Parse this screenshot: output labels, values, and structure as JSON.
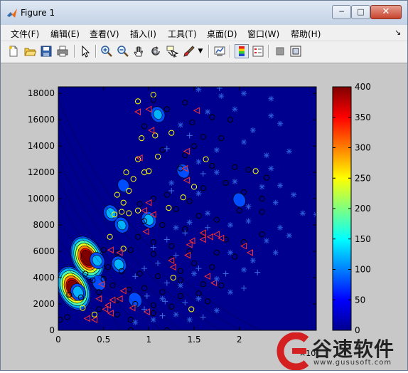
{
  "window": {
    "title": "Figure 1",
    "minimize_glyph": "─",
    "maximize_glyph": "□",
    "close_glyph": "✕"
  },
  "menu": {
    "items": [
      "文件(F)",
      "编辑(E)",
      "查看(V)",
      "插入(I)",
      "工具(T)",
      "桌面(D)",
      "窗口(W)",
      "帮助(H)"
    ],
    "arrow_glyph": "↘"
  },
  "toolbar": {
    "tools": [
      "new-figure-icon",
      "open-file-icon",
      "save-icon",
      "print-icon",
      "edit-plot-arrow-icon",
      "zoom-in-icon",
      "zoom-out-icon",
      "pan-hand-icon",
      "rotate-3d-icon",
      "data-cursor-icon",
      "brush-icon",
      "link-plot-icon",
      "colorbar-icon",
      "legend-icon",
      "hide-plot-tools-icon",
      "show-plot-tools-icon"
    ]
  },
  "chart_data": {
    "type": "heatmap",
    "plot_kind": "filled contour with scatter overlay",
    "title": "",
    "xlabel": "",
    "ylabel": "",
    "x_exponent_label": "×10",
    "xlim": [
      0,
      2.85
    ],
    "ylim": [
      0,
      18500
    ],
    "x_ticks": [
      0,
      0.5,
      1,
      1.5,
      2
    ],
    "x_tick_labels": [
      "0",
      "0.5",
      "1",
      "1.5",
      "2"
    ],
    "y_ticks": [
      0,
      2000,
      4000,
      6000,
      8000,
      10000,
      12000,
      14000,
      16000,
      18000
    ],
    "y_tick_labels": [
      "0",
      "2000",
      "4000",
      "6000",
      "8000",
      "10000",
      "12000",
      "14000",
      "16000",
      "18000"
    ],
    "colorbar": {
      "colormap": "jet",
      "min": 0,
      "max": 400,
      "ticks": [
        0,
        50,
        100,
        150,
        200,
        250,
        300,
        350,
        400
      ],
      "tick_labels": [
        "0",
        "50",
        "100",
        "150",
        "200",
        "250",
        "300",
        "350",
        "400"
      ]
    },
    "hotspots": [
      {
        "x": 0.17,
        "y": 3200,
        "peak": 400
      },
      {
        "x": 0.32,
        "y": 5500,
        "peak": 390
      },
      {
        "x": 0.22,
        "y": 2900,
        "peak": 120
      },
      {
        "x": 0.43,
        "y": 5300,
        "peak": 110
      },
      {
        "x": 0.58,
        "y": 8900,
        "peak": 110
      },
      {
        "x": 1.0,
        "y": 8400,
        "peak": 110
      },
      {
        "x": 0.67,
        "y": 5000,
        "peak": 110
      },
      {
        "x": 1.1,
        "y": 16400,
        "peak": 100
      },
      {
        "x": 0.7,
        "y": 8000,
        "peak": 100
      },
      {
        "x": 0.85,
        "y": 2300,
        "peak": 90
      },
      {
        "x": 0.45,
        "y": 3600,
        "peak": 90
      },
      {
        "x": 1.38,
        "y": 12100,
        "peak": 80
      },
      {
        "x": 2.0,
        "y": 9900,
        "peak": 80
      },
      {
        "x": 0.72,
        "y": 11000,
        "peak": 70
      }
    ],
    "series": [
      {
        "marker": "circle-yellow",
        "color": "#ffff00",
        "points": [
          [
            0.88,
            17400
          ],
          [
            1.05,
            17900
          ],
          [
            0.92,
            14600
          ],
          [
            1.07,
            14800
          ],
          [
            1.25,
            15000
          ],
          [
            0.88,
            13000
          ],
          [
            0.95,
            12000
          ],
          [
            1.0,
            12100
          ],
          [
            0.75,
            12000
          ],
          [
            0.83,
            11500
          ],
          [
            0.65,
            10300
          ],
          [
            0.78,
            10600
          ],
          [
            0.72,
            9700
          ],
          [
            0.62,
            8800
          ],
          [
            0.7,
            9000
          ],
          [
            0.78,
            8900
          ],
          [
            0.88,
            9100
          ],
          [
            1.22,
            9300
          ],
          [
            1.38,
            10100
          ],
          [
            1.5,
            10900
          ],
          [
            1.63,
            13000
          ],
          [
            2.18,
            12100
          ],
          [
            0.57,
            7100
          ],
          [
            0.27,
            1700
          ],
          [
            0.4,
            1200
          ],
          [
            1.27,
            4000
          ],
          [
            1.47,
            1600
          ],
          [
            0.72,
            6200
          ],
          [
            1.1,
            13200
          ]
        ]
      },
      {
        "marker": "circle-black",
        "color": "#000000",
        "points": [
          [
            1.05,
            17500
          ],
          [
            1.4,
            17300
          ],
          [
            1.2,
            16800
          ],
          [
            1.48,
            15800
          ],
          [
            1.7,
            16200
          ],
          [
            1.9,
            16000
          ],
          [
            0.95,
            15500
          ],
          [
            1.6,
            14700
          ],
          [
            1.8,
            14600
          ],
          [
            1.5,
            14000
          ],
          [
            1.15,
            13700
          ],
          [
            1.4,
            13300
          ],
          [
            1.7,
            12500
          ],
          [
            1.95,
            12400
          ],
          [
            2.1,
            12200
          ],
          [
            2.3,
            11600
          ],
          [
            1.85,
            11200
          ],
          [
            1.6,
            10800
          ],
          [
            2.05,
            10500
          ],
          [
            2.25,
            10000
          ],
          [
            1.05,
            10000
          ],
          [
            1.2,
            10300
          ],
          [
            1.45,
            9800
          ],
          [
            1.3,
            9200
          ],
          [
            1.55,
            8700
          ],
          [
            1.75,
            8400
          ],
          [
            2.0,
            9100
          ],
          [
            2.25,
            9000
          ],
          [
            0.9,
            9600
          ],
          [
            0.95,
            8300
          ],
          [
            1.15,
            8000
          ],
          [
            1.4,
            7700
          ],
          [
            1.6,
            7300
          ],
          [
            1.85,
            6900
          ],
          [
            2.05,
            6700
          ],
          [
            2.25,
            7300
          ],
          [
            0.88,
            7100
          ],
          [
            1.05,
            6700
          ],
          [
            1.25,
            6400
          ],
          [
            1.45,
            6000
          ],
          [
            1.75,
            5900
          ],
          [
            1.95,
            5600
          ],
          [
            0.65,
            5900
          ],
          [
            0.8,
            6100
          ],
          [
            1.05,
            5800
          ],
          [
            1.25,
            5400
          ],
          [
            1.5,
            5100
          ],
          [
            1.7,
            4800
          ],
          [
            0.55,
            4800
          ],
          [
            0.7,
            4500
          ],
          [
            0.9,
            4300
          ],
          [
            1.1,
            4100
          ],
          [
            1.35,
            3800
          ],
          [
            1.6,
            3500
          ],
          [
            1.8,
            3400
          ],
          [
            0.5,
            3900
          ],
          [
            0.6,
            3400
          ],
          [
            0.78,
            3100
          ],
          [
            0.95,
            3200
          ],
          [
            1.15,
            2900
          ],
          [
            1.35,
            2600
          ],
          [
            1.55,
            2800
          ],
          [
            0.45,
            2900
          ],
          [
            0.65,
            2300
          ],
          [
            0.85,
            2000
          ],
          [
            1.05,
            1900
          ],
          [
            1.25,
            1800
          ],
          [
            0.25,
            2500
          ],
          [
            0.45,
            1600
          ],
          [
            0.65,
            1200
          ],
          [
            0.8,
            800
          ],
          [
            1.05,
            1300
          ],
          [
            0.1,
            1000
          ],
          [
            0.02,
            800
          ],
          [
            0.8,
            0
          ],
          [
            1.2,
            0
          ],
          [
            0.3,
            4300
          ],
          [
            0.12,
            2700
          ],
          [
            1.35,
            4500
          ],
          [
            1.65,
            2200
          ],
          [
            0.38,
            3800
          ],
          [
            0.5,
            6100
          ],
          [
            1.35,
            12300
          ]
        ]
      },
      {
        "marker": "triangle-red",
        "color": "#ff3030",
        "points": [
          [
            0.88,
            16600
          ],
          [
            1.0,
            16800
          ],
          [
            1.53,
            16700
          ],
          [
            1.03,
            15200
          ],
          [
            1.42,
            13600
          ],
          [
            0.9,
            13100
          ],
          [
            1.4,
            12300
          ],
          [
            1.42,
            11400
          ],
          [
            1.0,
            9700
          ],
          [
            0.95,
            9100
          ],
          [
            1.05,
            8800
          ],
          [
            0.97,
            7500
          ],
          [
            1.6,
            7400
          ],
          [
            1.75,
            7300
          ],
          [
            1.68,
            7100
          ],
          [
            1.8,
            7000
          ],
          [
            1.48,
            6800
          ],
          [
            1.6,
            6900
          ],
          [
            1.45,
            6500
          ],
          [
            2.05,
            6400
          ],
          [
            2.12,
            5900
          ],
          [
            0.68,
            5900
          ],
          [
            1.43,
            5700
          ],
          [
            1.25,
            5300
          ],
          [
            1.27,
            4800
          ],
          [
            1.65,
            4100
          ],
          [
            1.72,
            3600
          ],
          [
            0.72,
            3000
          ],
          [
            0.68,
            2400
          ],
          [
            0.6,
            2300
          ],
          [
            0.82,
            1700
          ],
          [
            0.98,
            1400
          ],
          [
            0.58,
            1300
          ],
          [
            0.55,
            1900
          ],
          [
            0.32,
            900
          ],
          [
            0.4,
            800
          ],
          [
            0.52,
            1600
          ],
          [
            0.45,
            2400
          ],
          [
            0.58,
            6100
          ],
          [
            0.48,
            3500
          ]
        ]
      },
      {
        "marker": "star-blue",
        "color": "#2a5bd7",
        "points": [
          [
            1.55,
            18300
          ],
          [
            1.8,
            17800
          ],
          [
            2.05,
            18000
          ],
          [
            2.35,
            17600
          ],
          [
            1.65,
            16600
          ],
          [
            1.95,
            16800
          ],
          [
            2.35,
            16300
          ],
          [
            1.35,
            15600
          ],
          [
            2.15,
            15200
          ],
          [
            2.45,
            15700
          ],
          [
            1.75,
            13700
          ],
          [
            2.05,
            14300
          ],
          [
            2.3,
            13300
          ],
          [
            2.55,
            13600
          ],
          [
            1.55,
            12800
          ],
          [
            1.75,
            12000
          ],
          [
            2.35,
            12300
          ],
          [
            1.95,
            11300
          ],
          [
            2.45,
            11000
          ],
          [
            1.25,
            11200
          ],
          [
            1.55,
            10400
          ],
          [
            2.25,
            10900
          ],
          [
            2.6,
            10300
          ],
          [
            2.1,
            9400
          ],
          [
            2.4,
            9700
          ],
          [
            2.7,
            8900
          ],
          [
            1.65,
            8900
          ],
          [
            1.9,
            8000
          ],
          [
            2.1,
            8300
          ],
          [
            2.45,
            7800
          ],
          [
            1.3,
            7800
          ],
          [
            1.45,
            8200
          ],
          [
            2.3,
            6800
          ],
          [
            2.55,
            7200
          ],
          [
            1.9,
            5900
          ],
          [
            2.15,
            5300
          ],
          [
            2.4,
            5900
          ],
          [
            1.5,
            4300
          ],
          [
            1.75,
            3900
          ],
          [
            2.05,
            4600
          ],
          [
            1.35,
            3400
          ],
          [
            1.55,
            2400
          ],
          [
            1.9,
            2900
          ],
          [
            1.15,
            2400
          ],
          [
            1.3,
            1200
          ],
          [
            1.45,
            800
          ],
          [
            1.75,
            1500
          ],
          [
            0.85,
            600
          ],
          [
            1.05,
            800
          ],
          [
            2.85,
            8800
          ]
        ]
      },
      {
        "marker": "plus-blue",
        "color": "#3a6fe0",
        "points": [
          [
            1.78,
            18400
          ],
          [
            1.45,
            14800
          ],
          [
            1.2,
            13800
          ],
          [
            1.6,
            11900
          ],
          [
            1.25,
            10600
          ],
          [
            1.4,
            7400
          ],
          [
            1.65,
            7800
          ],
          [
            1.2,
            6900
          ],
          [
            1.05,
            6300
          ],
          [
            1.3,
            5700
          ],
          [
            1.1,
            5100
          ],
          [
            1.55,
            4700
          ],
          [
            0.95,
            4700
          ],
          [
            0.85,
            4100
          ],
          [
            1.2,
            3600
          ],
          [
            0.98,
            2600
          ],
          [
            1.18,
            2200
          ],
          [
            1.4,
            2100
          ],
          [
            0.95,
            1600
          ],
          [
            1.15,
            1100
          ],
          [
            1.6,
            1000
          ],
          [
            2.05,
            3200
          ],
          [
            2.2,
            4400
          ],
          [
            1.85,
            4300
          ]
        ]
      }
    ]
  },
  "watermark": {
    "title": "谷速软件",
    "url": "www.gususoft.com"
  }
}
